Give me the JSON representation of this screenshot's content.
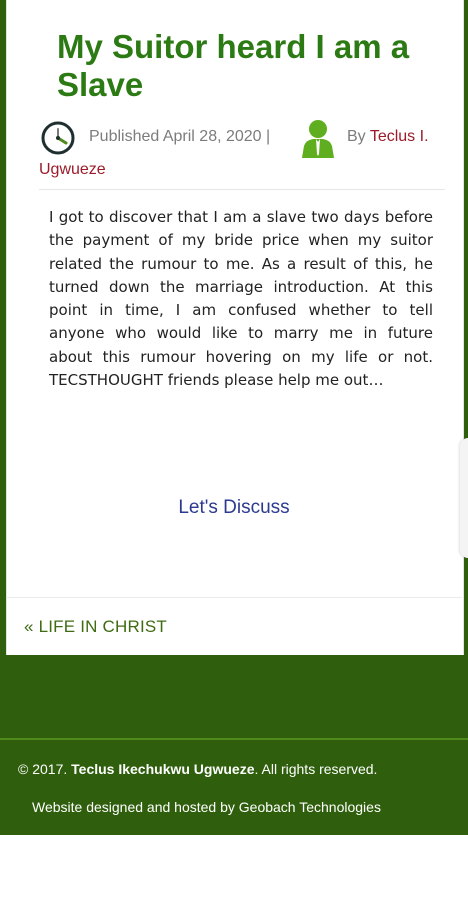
{
  "post": {
    "title": "My Suitor heard I am a Slave",
    "published_prefix": "Published",
    "published_date": "April 28, 2020",
    "separator": "|",
    "by_label": "By",
    "author_first": "Teclus I.",
    "author_last": "Ugwueze",
    "body": "I got to discover that I am a slave two days before the payment of my bride price when my suitor related the rumour to me. As a result of this, he turned down the marriage introduction. At this point in time, I am confused whether to tell anyone who would like to marry me in future about this rumour hovering on my life or not. TECSTHOUGHT friends please help me out…",
    "discuss_link": "Let's Discuss"
  },
  "navigation": {
    "previous_marker": "«",
    "previous_label": "LIFE IN CHRIST"
  },
  "footer": {
    "copyright_prefix": "© 2017.",
    "copyright_owner": "Teclus Ikechukwu Ugwueze",
    "copyright_suffix": ". All rights reserved.",
    "credits": "Website designed and hosted by Geobach Technologies"
  },
  "icons": {
    "clock": "clock-icon",
    "author": "user-icon"
  },
  "colors": {
    "title": "#2c7a14",
    "author_link": "#9b1b2a",
    "discuss_link": "#2b3a8f",
    "footer_bg": "#2f5f0c"
  }
}
